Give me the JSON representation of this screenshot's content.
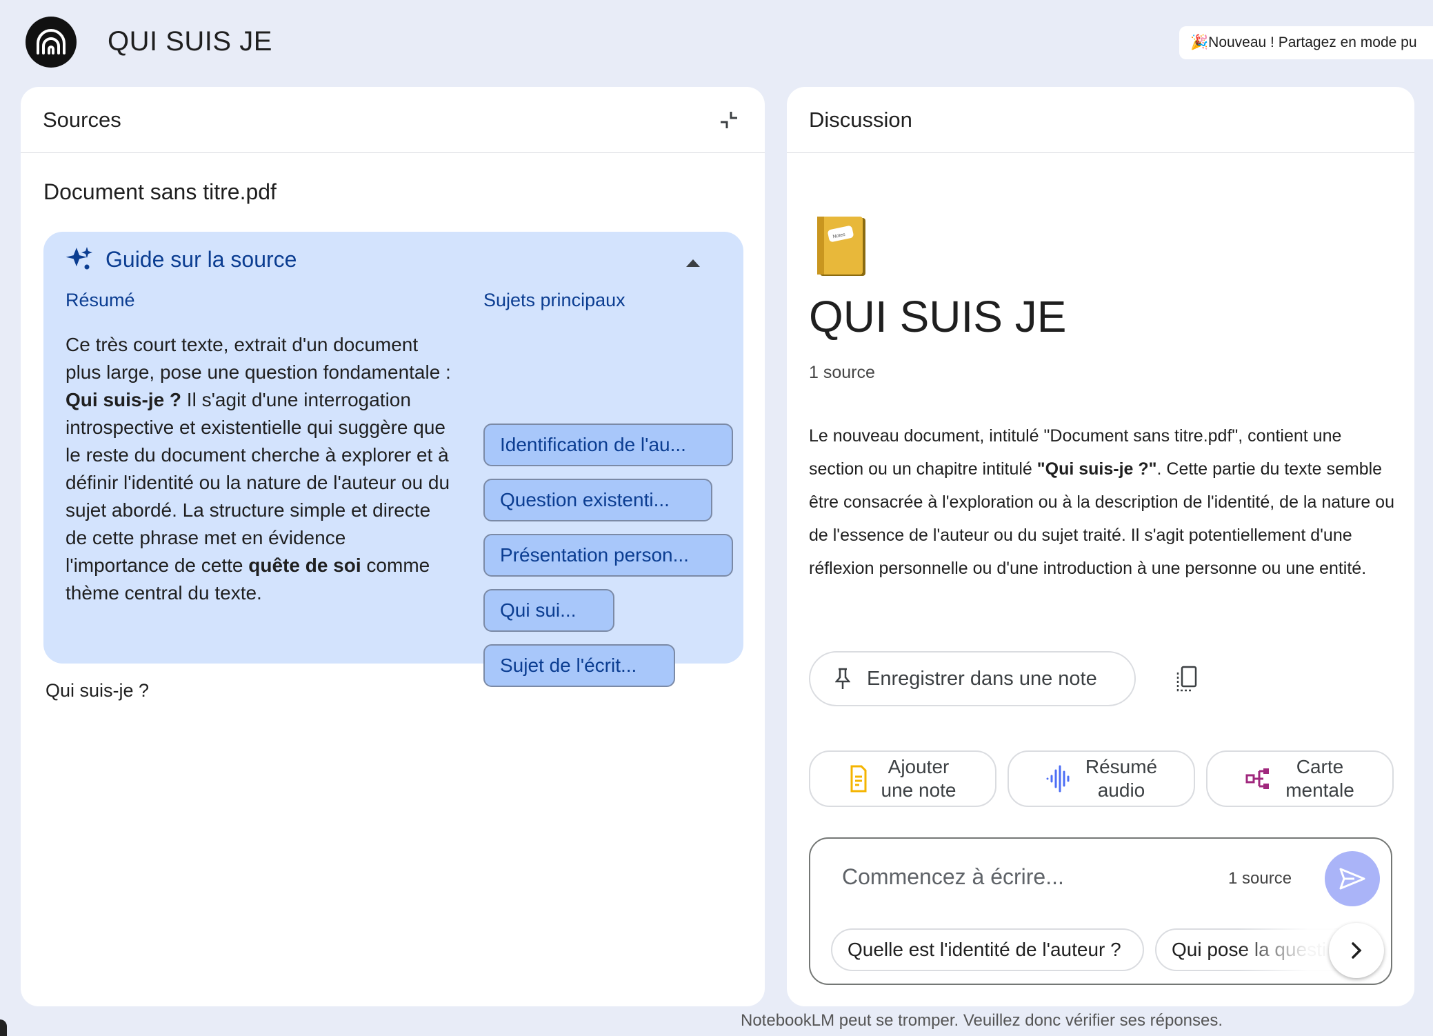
{
  "header": {
    "title": "QUI SUIS JE",
    "banner": "🎉Nouveau ! Partagez en mode pu"
  },
  "sources": {
    "title": "Sources",
    "document_title": "Document sans titre.pdf",
    "guide": {
      "title": "Guide sur la source",
      "summary_label": "Résumé",
      "topics_label": "Sujets principaux",
      "summary_part1": "Ce très court texte, extrait d'un document plus large, pose une question fondamentale : ",
      "summary_bold1": "Qui suis-je ?",
      "summary_part2": " Il s'agit d'une interrogation introspective et existentielle qui suggère que le reste du document cherche à explorer et à définir l'identité ou la nature de l'auteur ou du sujet abordé. La structure simple et directe de cette phrase met en évidence l'importance de cette ",
      "summary_bold2": "quête de soi",
      "summary_part3": " comme thème central du texte.",
      "topics": [
        "Identification de l'au...",
        "Question existenti...",
        "Présentation person...",
        "Qui sui...",
        "Sujet de l'écrit..."
      ]
    },
    "body_text": "Qui suis-je ?"
  },
  "chat": {
    "title": "Discussion",
    "notebook_title": "QUI SUIS JE",
    "source_count": "1 source",
    "summary_part1": "Le nouveau document, intitulé \"Document sans titre.pdf\", contient une section ou un chapitre intitulé ",
    "summary_bold": "\"Qui suis-je ?\"",
    "summary_part2": ". Cette partie du texte semble être consacrée à l'exploration ou à la description de l'identité, de la nature ou de l'essence de l'auteur ou du sujet traité. Il s'agit potentiellement d'une réflexion personnelle ou d'une introduction à une personne ou une entité.",
    "save_note_label": "Enregistrer dans une note",
    "actions": [
      {
        "line1": "Ajouter",
        "line2": "une note"
      },
      {
        "line1": "Résumé",
        "line2": "audio"
      },
      {
        "line1": "Carte",
        "line2": "mentale"
      }
    ],
    "composer": {
      "placeholder": "Commencez à écrire...",
      "source_count": "1 source"
    },
    "suggestions": [
      "Quelle est l'identité de l'auteur ?",
      "Qui pose la questi"
    ]
  },
  "footer": "NotebookLM peut se tromper. Veuillez donc vérifier ses réponses.",
  "colors": {
    "background": "#e8ecf7",
    "guide_bg": "#d3e3fd",
    "topic_bg": "#a8c7fa",
    "accent_blue": "#0b3d91",
    "send_button": "#aab4f8"
  },
  "icons": {
    "logo": "notebooklm-logo-icon",
    "collapse": "collapse-panel-icon",
    "sparkle": "sparkle-icon",
    "caret": "caret-up-icon",
    "notebook": "notebook-icon",
    "pin": "pin-icon",
    "copy": "copy-icon",
    "note": "note-icon",
    "audio": "audio-waveform-icon",
    "mindmap": "mind-map-icon",
    "send": "send-icon",
    "next": "chevron-right-icon"
  }
}
